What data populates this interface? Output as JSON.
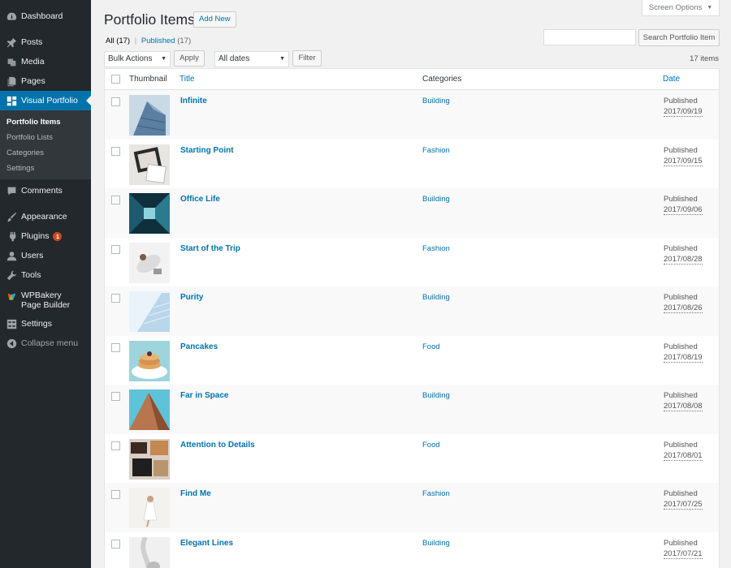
{
  "sidebar": {
    "items": [
      {
        "label": "Dashboard",
        "icon": "dashboard-icon"
      },
      {
        "label": "Posts",
        "icon": "pin-icon"
      },
      {
        "label": "Media",
        "icon": "media-icon"
      },
      {
        "label": "Pages",
        "icon": "pages-icon"
      },
      {
        "label": "Visual Portfolio",
        "icon": "grid-icon"
      },
      {
        "label": "Comments",
        "icon": "comment-icon"
      },
      {
        "label": "Appearance",
        "icon": "brush-icon"
      },
      {
        "label": "Plugins",
        "icon": "plug-icon",
        "badge": "1"
      },
      {
        "label": "Users",
        "icon": "user-icon"
      },
      {
        "label": "Tools",
        "icon": "wrench-icon"
      },
      {
        "label": "WPBakery Page Builder",
        "icon": "wpbakery-icon"
      },
      {
        "label": "Settings",
        "icon": "settings-icon"
      },
      {
        "label": "Collapse menu",
        "icon": "collapse-icon"
      }
    ],
    "submenu": [
      "Portfolio Items",
      "Portfolio Lists",
      "Categories",
      "Settings"
    ]
  },
  "header": {
    "screen_options": "Screen Options",
    "title": "Portfolio Items",
    "add_new": "Add New"
  },
  "filters": {
    "all_label": "All",
    "all_count": "(17)",
    "published_label": "Published",
    "published_count": "(17)",
    "separator": "|",
    "bulk_actions": "Bulk Actions",
    "apply": "Apply",
    "dates": "All dates",
    "filter": "Filter",
    "search_button": "Search Portfolio Item",
    "search_value": "",
    "item_count": "17 items"
  },
  "table": {
    "headers": {
      "thumbnail": "Thumbnail",
      "title": "Title",
      "categories": "Categories",
      "date": "Date"
    },
    "rows": [
      {
        "title": "Infinite",
        "category": "Building",
        "status": "Published",
        "date": "2017/09/19"
      },
      {
        "title": "Starting Point",
        "category": "Fashion",
        "status": "Published",
        "date": "2017/09/15"
      },
      {
        "title": "Office Life",
        "category": "Building",
        "status": "Published",
        "date": "2017/09/06"
      },
      {
        "title": "Start of the Trip",
        "category": "Fashion",
        "status": "Published",
        "date": "2017/08/28"
      },
      {
        "title": "Purity",
        "category": "Building",
        "status": "Published",
        "date": "2017/08/26"
      },
      {
        "title": "Pancakes",
        "category": "Food",
        "status": "Published",
        "date": "2017/08/19"
      },
      {
        "title": "Far in Space",
        "category": "Building",
        "status": "Published",
        "date": "2017/08/08"
      },
      {
        "title": "Attention to Details",
        "category": "Food",
        "status": "Published",
        "date": "2017/08/01"
      },
      {
        "title": "Find Me",
        "category": "Fashion",
        "status": "Published",
        "date": "2017/07/25"
      },
      {
        "title": "Elegant Lines",
        "category": "Building",
        "status": "Published",
        "date": "2017/07/21"
      }
    ]
  },
  "colors": {
    "accent": "#0073aa",
    "sidebar_bg": "#23282d",
    "badge": "#ca4a1f"
  }
}
